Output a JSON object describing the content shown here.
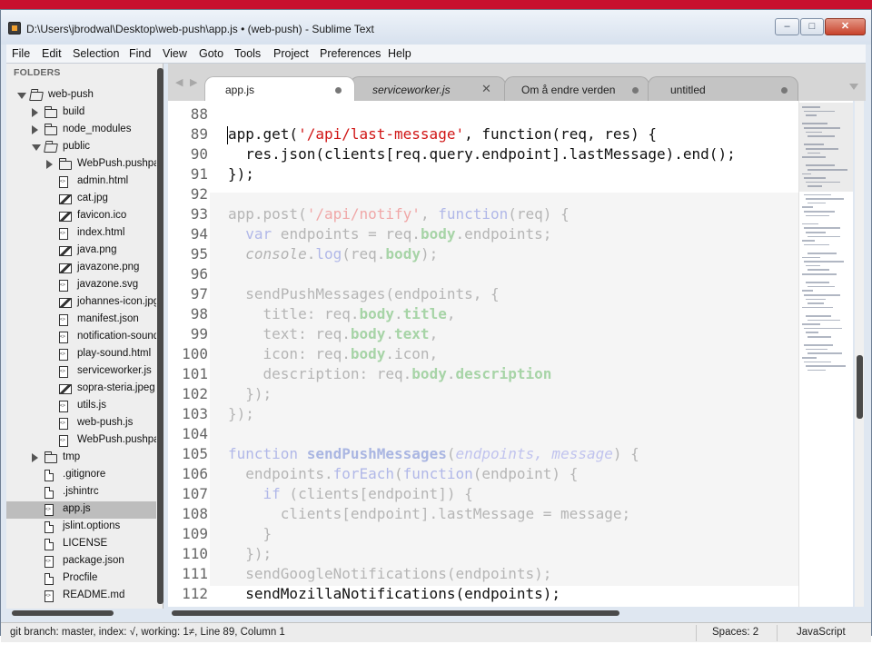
{
  "window": {
    "title": "D:\\Users\\jbrodwal\\Desktop\\web-push\\app.js • (web-push) - Sublime Text",
    "controls": {
      "minimize": "–",
      "maximize": "□",
      "close": "✕"
    }
  },
  "menu": [
    "File",
    "Edit",
    "Selection",
    "Find",
    "View",
    "Goto",
    "Tools",
    "Project",
    "Preferences",
    "Help"
  ],
  "sidebar": {
    "header": "FOLDERS",
    "items": [
      {
        "label": "web-push",
        "type": "folder-open",
        "arrow": "down",
        "depth": 0
      },
      {
        "label": "build",
        "type": "folder",
        "arrow": "right",
        "depth": 1
      },
      {
        "label": "node_modules",
        "type": "folder",
        "arrow": "right",
        "depth": 1
      },
      {
        "label": "public",
        "type": "folder-open",
        "arrow": "down",
        "depth": 1
      },
      {
        "label": "WebPush.pushpackage",
        "type": "folder",
        "arrow": "right",
        "depth": 2
      },
      {
        "label": "admin.html",
        "type": "code",
        "depth": 2
      },
      {
        "label": "cat.jpg",
        "type": "image",
        "depth": 2
      },
      {
        "label": "favicon.ico",
        "type": "image",
        "depth": 2
      },
      {
        "label": "index.html",
        "type": "code",
        "depth": 2
      },
      {
        "label": "java.png",
        "type": "image",
        "depth": 2
      },
      {
        "label": "javazone.png",
        "type": "image",
        "depth": 2
      },
      {
        "label": "javazone.svg",
        "type": "code",
        "depth": 2
      },
      {
        "label": "johannes-icon.jpg",
        "type": "image",
        "depth": 2
      },
      {
        "label": "manifest.json",
        "type": "code",
        "depth": 2
      },
      {
        "label": "notification-sound",
        "type": "code",
        "depth": 2
      },
      {
        "label": "play-sound.html",
        "type": "code",
        "depth": 2
      },
      {
        "label": "serviceworker.js",
        "type": "code",
        "depth": 2
      },
      {
        "label": "sopra-steria.jpeg",
        "type": "image",
        "depth": 2
      },
      {
        "label": "utils.js",
        "type": "code",
        "depth": 2
      },
      {
        "label": "web-push.js",
        "type": "code",
        "depth": 2
      },
      {
        "label": "WebPush.pushpackage",
        "type": "code",
        "depth": 2
      },
      {
        "label": "tmp",
        "type": "folder",
        "arrow": "right",
        "depth": 1
      },
      {
        "label": ".gitignore",
        "type": "file",
        "depth": 1
      },
      {
        "label": ".jshintrc",
        "type": "file",
        "depth": 1
      },
      {
        "label": "app.js",
        "type": "code",
        "depth": 1,
        "selected": true
      },
      {
        "label": "jslint.options",
        "type": "file",
        "depth": 1
      },
      {
        "label": "LICENSE",
        "type": "file",
        "depth": 1
      },
      {
        "label": "package.json",
        "type": "code",
        "depth": 1
      },
      {
        "label": "Procfile",
        "type": "file",
        "depth": 1
      },
      {
        "label": "README.md",
        "type": "code",
        "depth": 1
      }
    ]
  },
  "tabs": [
    {
      "label": "app.js",
      "active": true,
      "italic": false,
      "dirty": true
    },
    {
      "label": "serviceworker.js",
      "active": false,
      "italic": true,
      "close": "✕"
    },
    {
      "label": "Om å endre verden",
      "active": false,
      "italic": false,
      "dirty": true
    },
    {
      "label": "untitled",
      "active": false,
      "italic": false,
      "dirty": true
    }
  ],
  "tab_nav": {
    "back": "◀",
    "forward": "▶"
  },
  "editor": {
    "line_numbers": [
      "88",
      "89",
      "90",
      "91",
      "92",
      "93",
      "94",
      "95",
      "96",
      "97",
      "98",
      "99",
      "100",
      "101",
      "102",
      "103",
      "104",
      "105",
      "106",
      "107",
      "108",
      "109",
      "110",
      "111",
      "112"
    ],
    "lines": [
      {
        "n": "88",
        "faded": false,
        "spans": []
      },
      {
        "n": "89",
        "faded": false,
        "spans": [
          [
            "",
            "app.get("
          ],
          [
            "str",
            "'/api/last-message'"
          ],
          [
            "",
            ", function(req, res) {"
          ]
        ]
      },
      {
        "n": "90",
        "faded": false,
        "spans": [
          [
            "",
            "  res.json(clients[req.query.endpoint].lastMessage).end();"
          ]
        ]
      },
      {
        "n": "91",
        "faded": false,
        "spans": [
          [
            "",
            "});"
          ]
        ]
      },
      {
        "n": "92",
        "faded": true,
        "spans": []
      },
      {
        "n": "93",
        "faded": true,
        "spans": [
          [
            "",
            "app.post("
          ],
          [
            "str",
            "'/api/notify'"
          ],
          [
            "",
            ", "
          ],
          [
            "kw",
            "function"
          ],
          [
            "",
            "(req) {"
          ]
        ]
      },
      {
        "n": "94",
        "faded": true,
        "spans": [
          [
            "",
            "  "
          ],
          [
            "kw",
            "var"
          ],
          [
            "",
            " endpoints = req."
          ],
          [
            "prb",
            "body"
          ],
          [
            "",
            ".endpoints;"
          ]
        ]
      },
      {
        "n": "95",
        "faded": true,
        "spans": [
          [
            "",
            "  "
          ],
          [
            "it",
            "console"
          ],
          [
            "",
            "."
          ],
          [
            "kw",
            "log"
          ],
          [
            "",
            "(req."
          ],
          [
            "prb",
            "body"
          ],
          [
            "",
            ");"
          ]
        ]
      },
      {
        "n": "96",
        "faded": true,
        "spans": []
      },
      {
        "n": "97",
        "faded": true,
        "spans": [
          [
            "",
            "  sendPushMessages(endpoints, {"
          ]
        ]
      },
      {
        "n": "98",
        "faded": true,
        "spans": [
          [
            "",
            "    title: req."
          ],
          [
            "prb",
            "body"
          ],
          [
            "",
            "."
          ],
          [
            "prb",
            "title"
          ],
          [
            "",
            ","
          ]
        ]
      },
      {
        "n": "99",
        "faded": true,
        "spans": [
          [
            "",
            "    text: req."
          ],
          [
            "prb",
            "body"
          ],
          [
            "",
            "."
          ],
          [
            "prb",
            "text"
          ],
          [
            "",
            ","
          ]
        ]
      },
      {
        "n": "100",
        "faded": true,
        "spans": [
          [
            "",
            "    icon: req."
          ],
          [
            "prb",
            "body"
          ],
          [
            "",
            ".icon,"
          ]
        ]
      },
      {
        "n": "101",
        "faded": true,
        "spans": [
          [
            "",
            "    description: req."
          ],
          [
            "prb",
            "body"
          ],
          [
            "",
            "."
          ],
          [
            "prb",
            "description"
          ]
        ]
      },
      {
        "n": "102",
        "faded": true,
        "spans": [
          [
            "",
            "  });"
          ]
        ]
      },
      {
        "n": "103",
        "faded": true,
        "spans": [
          [
            "",
            "});"
          ]
        ]
      },
      {
        "n": "104",
        "faded": true,
        "spans": []
      },
      {
        "n": "105",
        "faded": true,
        "spans": [
          [
            "kw",
            "function"
          ],
          [
            "",
            " "
          ],
          [
            "fn",
            "sendPushMessages"
          ],
          [
            "",
            "("
          ],
          [
            "par",
            "endpoints, message"
          ],
          [
            "",
            ") {"
          ]
        ]
      },
      {
        "n": "106",
        "faded": true,
        "spans": [
          [
            "",
            "  endpoints."
          ],
          [
            "kw",
            "forEach"
          ],
          [
            "",
            "("
          ],
          [
            "kw",
            "function"
          ],
          [
            "",
            "(endpoint) {"
          ]
        ]
      },
      {
        "n": "107",
        "faded": true,
        "spans": [
          [
            "",
            "    "
          ],
          [
            "kw",
            "if"
          ],
          [
            "",
            " (clients[endpoint]) {"
          ]
        ]
      },
      {
        "n": "108",
        "faded": true,
        "spans": [
          [
            "",
            "      clients[endpoint].lastMessage = message;"
          ]
        ]
      },
      {
        "n": "109",
        "faded": true,
        "spans": [
          [
            "",
            "    }"
          ]
        ]
      },
      {
        "n": "110",
        "faded": true,
        "spans": [
          [
            "",
            "  });"
          ]
        ]
      },
      {
        "n": "111",
        "faded": true,
        "spans": [
          [
            "",
            "  sendGoogleNotifications(endpoints);"
          ]
        ]
      },
      {
        "n": "112",
        "faded": false,
        "spans": [
          [
            "",
            "  sendMozillaNotifications(endpoints);"
          ]
        ]
      }
    ],
    "cursor_line": "89",
    "cursor_column": "1"
  },
  "status": {
    "left": "git branch: master, index: √, working: 1≠, Line 89, Column 1",
    "spaces": "Spaces: 2",
    "syntax": "JavaScript"
  },
  "colors": {
    "accent_bar": "#c8102e",
    "string": "#d01515",
    "sidebar_bg": "#eeeeee",
    "selected_item": "#bdbdbd"
  }
}
